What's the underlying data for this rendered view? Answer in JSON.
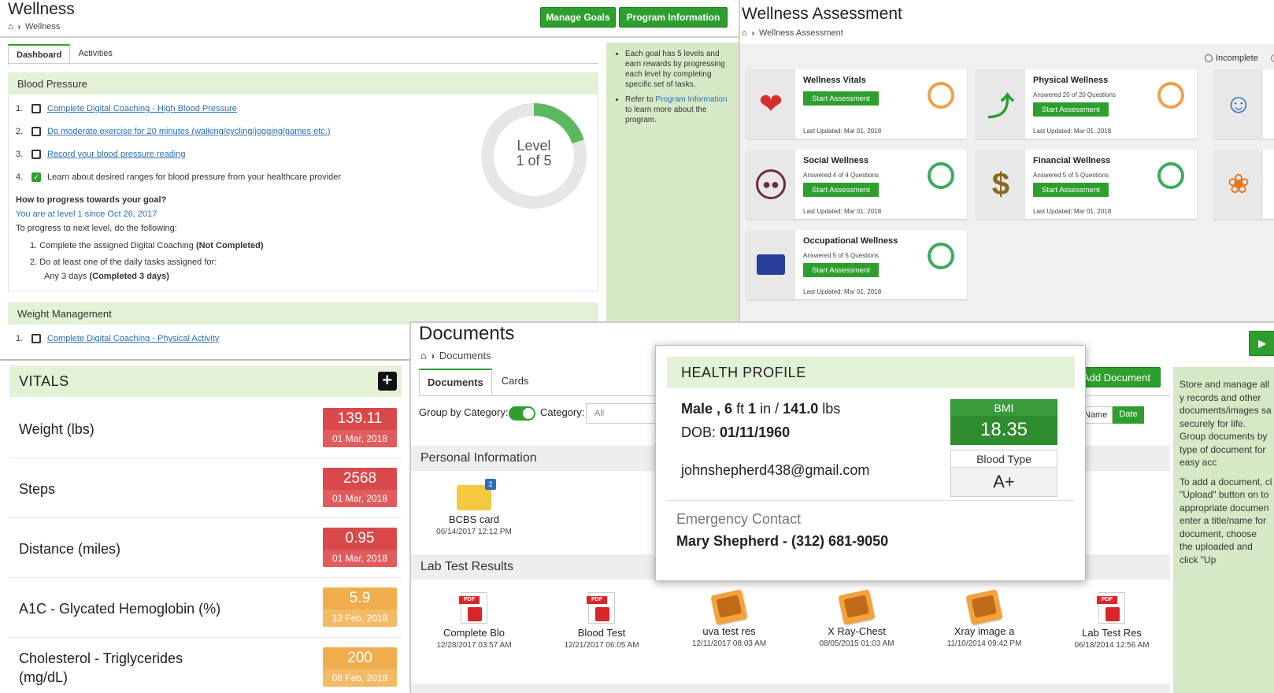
{
  "wellness": {
    "title": "Wellness",
    "breadcrumb": "Wellness",
    "buttons": {
      "manage_goals": "Manage Goals",
      "program_info": "Program Information"
    },
    "tabs": [
      "Dashboard",
      "Activities"
    ],
    "blood_pressure": {
      "heading": "Blood Pressure",
      "tasks": [
        {
          "num": "1.",
          "text": "Complete Digital Coaching - High Blood Pressure",
          "checked": false,
          "link": true
        },
        {
          "num": "2.",
          "text": "Do moderate exercise for 20 minutes (walking/cycling/jogging/games etc.)",
          "checked": false,
          "link": true
        },
        {
          "num": "3.",
          "text": "Record your blood pressure reading",
          "checked": false,
          "link": true
        },
        {
          "num": "4.",
          "text": "Learn about desired ranges for blood pressure from your healthcare provider",
          "checked": true,
          "link": false
        }
      ],
      "progress_question": "How to progress towards your goal?",
      "level_since": "You are at level 1 since Oct 26, 2017",
      "to_progress": "To progress to next level, do the following:",
      "step1": "1. Complete the assigned Digital Coaching",
      "step1_status": "(Not Completed)",
      "step2": "2. Do at least one of the daily tasks assigned for:",
      "step2_sub": "Any 3 days",
      "step2_status": "(Completed 3 days)",
      "level_word": "Level",
      "level_of": "1 of 5",
      "level_fraction": 0.2
    },
    "weight_management": {
      "heading": "Weight Management",
      "task_num": "1.",
      "task": "Complete Digital Coaching - Physical Activity"
    },
    "sidebar": {
      "note1": "Each goal has 5 levels and earn rewards by progressing each level by completing specific set of tasks.",
      "note2_pre": "Refer to ",
      "note2_link": "Program Information",
      "note2_post": " to learn more about the program."
    }
  },
  "assessment": {
    "title": "Wellness Assessment",
    "breadcrumb": "Wellness Assessment",
    "legend_incomplete": "Incomplete",
    "cards": [
      {
        "title": "Wellness Vitals",
        "sub": "",
        "button": "Start Assessment",
        "updated": "Last Updated: Mar 01, 2018",
        "icon": "heart-pulse-icon",
        "status": "incomplete"
      },
      {
        "title": "Physical Wellness",
        "sub": "Answered 20 of 20 Questions",
        "button": "Start Assessment",
        "updated": "Last Updated: Mar 01, 2018",
        "icon": "running-person-icon",
        "status": "incomplete"
      },
      {
        "title": "Social Wellness",
        "sub": "Answered 4 of 4 Questions",
        "button": "Start Assessment",
        "updated": "Last Updated: Mar 01, 2018",
        "icon": "group-icon",
        "status": "complete"
      },
      {
        "title": "Financial Wellness",
        "sub": "Answered 5 of 5 Questions",
        "button": "Start Assessment",
        "updated": "Last Updated: Mar 01, 2018",
        "icon": "dollar-icon",
        "status": "complete"
      },
      {
        "title": "Occupational Wellness",
        "sub": "Answered 5 of 5 Questions",
        "button": "Start Assessment",
        "updated": "Last Updated: Mar 01, 2018",
        "icon": "briefcase-icon",
        "status": "complete"
      }
    ]
  },
  "vitals": {
    "title": "VITALS",
    "rows": [
      {
        "label": "Weight (lbs)",
        "value": "139.11",
        "date": "01 Mar, 2018",
        "color": "red"
      },
      {
        "label": "Steps",
        "value": "2568",
        "date": "01 Mar, 2018",
        "color": "red"
      },
      {
        "label": "Distance (miles)",
        "value": "0.95",
        "date": "01 Mar, 2018",
        "color": "red"
      },
      {
        "label": "A1C - Glycated Hemoglobin (%)",
        "value": "5.9",
        "date": "13 Feb, 2018",
        "color": "orange"
      },
      {
        "label": "Cholesterol - Triglycerides",
        "label2": "(mg/dL)",
        "value": "200",
        "date": "08 Feb, 2018",
        "color": "orange"
      }
    ]
  },
  "documents": {
    "title": "Documents",
    "breadcrumb": "Documents",
    "tabs": [
      "Documents",
      "Cards"
    ],
    "group_by_label": "Group by Category:",
    "category_label": "Category:",
    "category_value": "All",
    "add_document": "Add Document",
    "sort_name": "Name",
    "sort_date": "Date",
    "personal_info": "Personal Information",
    "folder": {
      "name": "BCBS card",
      "date": "06/14/2017 12:12 PM",
      "count": "2"
    },
    "lab_results": "Lab Test Results",
    "lab_items": [
      {
        "name": "Complete Blo",
        "date": "12/28/2017 03:57 AM",
        "type": "pdf"
      },
      {
        "name": "Blood Test",
        "date": "12/21/2017 06:05 AM",
        "type": "pdf"
      },
      {
        "name": "uva test res",
        "date": "12/11/2017 08:03 AM",
        "type": "image"
      },
      {
        "name": "X Ray-Chest",
        "date": "08/05/2015 01:03 AM",
        "type": "image"
      },
      {
        "name": "Xray image a",
        "date": "11/10/2014 09:42 PM",
        "type": "image"
      },
      {
        "name": "Lab Test Res",
        "date": "06/18/2014 12:56 AM",
        "type": "pdf"
      }
    ],
    "pdf_label": "PDF",
    "sidebar_p1": "Store and manage all y records and other documents/images sa securely for life. Group documents by type of document for easy acc",
    "sidebar_p2": "To add a document, cl \"Upload\" button on to appropriate documen enter a title/name for document, choose the uploaded and click \"Up"
  },
  "health_profile": {
    "title": "HEALTH PROFILE",
    "gender": "Male ,",
    "height_ft": "6",
    "ft": "ft",
    "height_in": "1",
    "in_sep": "in /",
    "weight": "141.0",
    "lbs": "lbs",
    "dob_label": "DOB:",
    "dob": "01/11/1960",
    "email": "johnshepherd438@gmail.com",
    "bmi_label": "BMI",
    "bmi": "18.35",
    "blood_type_label": "Blood Type",
    "blood_type": "A+",
    "emergency_label": "Emergency Contact",
    "emergency_contact": "Mary Shepherd - (312) 681-9050"
  }
}
